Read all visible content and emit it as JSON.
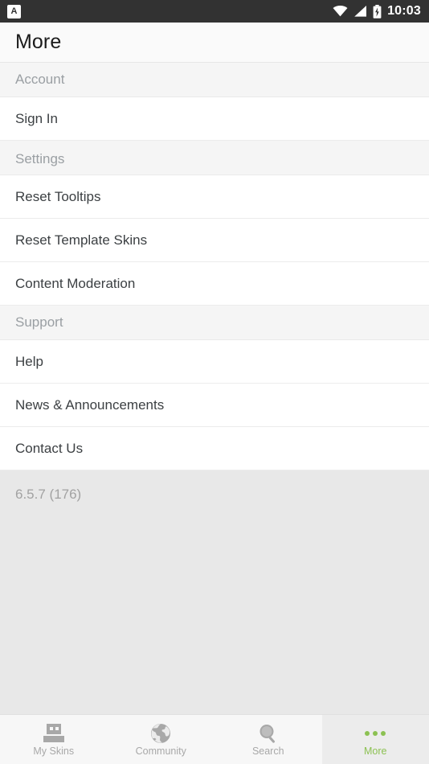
{
  "statusbar": {
    "app_icon": "app-notification-icon",
    "app_icon_letter": "A",
    "icons": [
      "wifi-icon",
      "cellular-signal-icon",
      "battery-charging-icon"
    ],
    "time": "10:03"
  },
  "titlebar": {
    "title": "More"
  },
  "sections": [
    {
      "header": "Account",
      "items": [
        {
          "label": "Sign In"
        }
      ]
    },
    {
      "header": "Settings",
      "items": [
        {
          "label": "Reset Tooltips"
        },
        {
          "label": "Reset Template Skins"
        },
        {
          "label": "Content Moderation"
        }
      ]
    },
    {
      "header": "Support",
      "items": [
        {
          "label": "Help"
        },
        {
          "label": "News & Announcements"
        },
        {
          "label": "Contact Us"
        }
      ]
    }
  ],
  "version": "6.5.7 (176)",
  "bottom_nav": {
    "tabs": [
      {
        "label": "My Skins",
        "icon": "minecraft-skin-icon",
        "active": false
      },
      {
        "label": "Community",
        "icon": "globe-icon",
        "active": false
      },
      {
        "label": "Search",
        "icon": "magnifier-icon",
        "active": false
      },
      {
        "label": "More",
        "icon": "ellipsis-icon",
        "active": true
      }
    ]
  },
  "colors": {
    "accent_green": "#8cc152",
    "statusbar_bg": "#323232",
    "section_header_bg": "#f5f5f5",
    "row_bg": "#ffffff",
    "footer_bg": "#e8e8e8",
    "primary_text": "#3c4043",
    "muted_text": "#9a9fa3"
  }
}
